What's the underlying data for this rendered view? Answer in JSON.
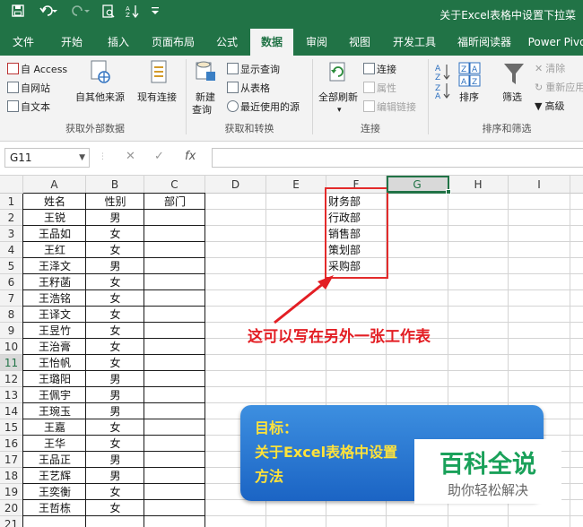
{
  "titlebar": {
    "save_icon": "save-icon",
    "undo_icon": "undo-icon",
    "redo_icon": "redo-icon",
    "preview_icon": "print-preview-icon",
    "sort_icon": "sort-az-icon",
    "customize_icon": "customize-quick-access-icon",
    "title": "关于Excel表格中设置下拉菜"
  },
  "tabs": [
    "文件",
    "开始",
    "插入",
    "页面布局",
    "公式",
    "数据",
    "审阅",
    "视图",
    "开发工具",
    "福昕阅读器",
    "Power Pivo"
  ],
  "active_tab": "数据",
  "ribbon": {
    "get_external": {
      "access": "自 Access",
      "web": "自网站",
      "text": "自文本",
      "other": "自其他来源",
      "existing": "现有连接",
      "label": "获取外部数据"
    },
    "transform": {
      "new_query": "新建",
      "new_query2": "查询",
      "show_queries": "显示查询",
      "from_table": "从表格",
      "recent": "最近使用的源",
      "label": "获取和转换"
    },
    "connections": {
      "refresh": "全部刷新",
      "connections": "连接",
      "properties": "属性",
      "edit_links": "编辑链接",
      "label": "连接"
    },
    "sort_filter": {
      "sort": "排序",
      "filter": "筛选",
      "clear": "清除",
      "reapply": "重新应用",
      "advanced": "高级",
      "label": "排序和筛选"
    }
  },
  "formula_bar": {
    "name_box": "G11",
    "cancel_icon": "cancel-icon",
    "enter_icon": "check-icon",
    "fx": "fx",
    "value": ""
  },
  "sheet": {
    "columns": [
      "A",
      "B",
      "C",
      "D",
      "E",
      "F",
      "G",
      "H",
      "I"
    ],
    "selected_column": "G",
    "selected_row": "11",
    "rows": [
      "1",
      "2",
      "3",
      "4",
      "5",
      "6",
      "7",
      "8",
      "9",
      "10",
      "11",
      "12",
      "13",
      "14",
      "15",
      "16",
      "17",
      "18",
      "19",
      "20",
      "21"
    ],
    "header": {
      "name": "姓名",
      "gender": "性别",
      "dept": "部门"
    },
    "people": [
      {
        "name": "王锐",
        "gender": "男"
      },
      {
        "name": "王品如",
        "gender": "女"
      },
      {
        "name": "王红",
        "gender": "女"
      },
      {
        "name": "王泽文",
        "gender": "男"
      },
      {
        "name": "王籽菡",
        "gender": "女"
      },
      {
        "name": "王浩铭",
        "gender": "女"
      },
      {
        "name": "王译文",
        "gender": "女"
      },
      {
        "name": "王昱竹",
        "gender": "女"
      },
      {
        "name": "王治膏",
        "gender": "女"
      },
      {
        "name": "王怡帆",
        "gender": "女"
      },
      {
        "name": "王璐阳",
        "gender": "男"
      },
      {
        "name": "王佩宇",
        "gender": "男"
      },
      {
        "name": "王琬玉",
        "gender": "男"
      },
      {
        "name": "王嘉",
        "gender": "女"
      },
      {
        "name": "王华",
        "gender": "女"
      },
      {
        "name": "王品正",
        "gender": "男"
      },
      {
        "name": "王艺辉",
        "gender": "男"
      },
      {
        "name": "王奕衡",
        "gender": "女"
      },
      {
        "name": "王哲栋",
        "gender": "女"
      }
    ],
    "dept_list": [
      "财务部",
      "行政部",
      "销售部",
      "策划部",
      "采购部"
    ]
  },
  "annotation": "这可以写在另外一张工作表",
  "promo": {
    "line1": "目标：",
    "line2": "关于Excel表格中设置",
    "line3": "方法"
  },
  "watermark": {
    "main": "百科全说",
    "sub": "助你轻松解决"
  },
  "colors": {
    "excel_green": "#217346",
    "annotation_red": "#e31e24",
    "promo_blue": "#2a7ad2",
    "promo_text": "#ffe23a",
    "watermark_green": "#1aa15a"
  }
}
